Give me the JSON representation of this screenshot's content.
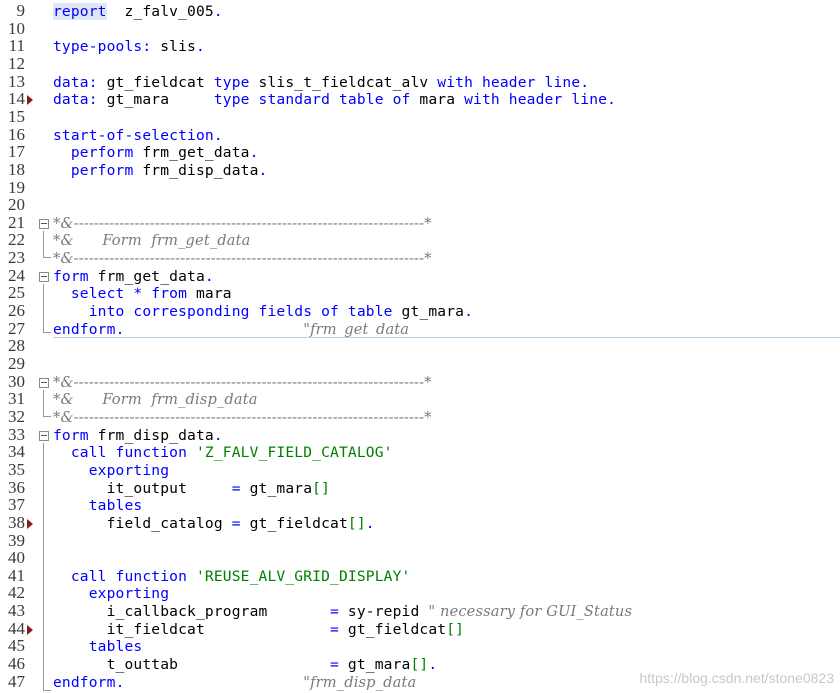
{
  "editor": {
    "highlight_line": "9",
    "lines": [
      {
        "num": "9",
        "marker": false,
        "fold": false,
        "segs": [
          {
            "t": "report",
            "c": "kw"
          },
          {
            "t": "  z_falv_005",
            "c": ""
          },
          {
            "t": ".",
            "c": "kw"
          }
        ]
      },
      {
        "num": "10",
        "marker": false,
        "fold": false,
        "segs": []
      },
      {
        "num": "11",
        "marker": false,
        "fold": false,
        "segs": [
          {
            "t": "type-pools:",
            "c": "kw"
          },
          {
            "t": " slis",
            "c": ""
          },
          {
            "t": ".",
            "c": "kw"
          }
        ]
      },
      {
        "num": "12",
        "marker": false,
        "fold": false,
        "segs": []
      },
      {
        "num": "13",
        "marker": false,
        "fold": false,
        "segs": [
          {
            "t": "data:",
            "c": "kw"
          },
          {
            "t": " gt_fieldcat ",
            "c": ""
          },
          {
            "t": "type",
            "c": "kw"
          },
          {
            "t": " slis_t_fieldcat_alv ",
            "c": ""
          },
          {
            "t": "with header line",
            "c": "kw"
          },
          {
            "t": ".",
            "c": "kw"
          }
        ]
      },
      {
        "num": "14",
        "marker": true,
        "fold": false,
        "segs": [
          {
            "t": "data:",
            "c": "kw"
          },
          {
            "t": " gt_mara     ",
            "c": ""
          },
          {
            "t": "type standard table of",
            "c": "kw"
          },
          {
            "t": " mara ",
            "c": ""
          },
          {
            "t": "with header line",
            "c": "kw"
          },
          {
            "t": ".",
            "c": "kw"
          }
        ]
      },
      {
        "num": "15",
        "marker": false,
        "fold": false,
        "segs": []
      },
      {
        "num": "16",
        "marker": false,
        "fold": false,
        "segs": [
          {
            "t": "start-of-selection",
            "c": "kw"
          },
          {
            "t": ".",
            "c": "kw"
          }
        ]
      },
      {
        "num": "17",
        "marker": false,
        "fold": false,
        "segs": [
          {
            "t": "  perform",
            "c": "kw"
          },
          {
            "t": " frm_get_data",
            "c": ""
          },
          {
            "t": ".",
            "c": "kw"
          }
        ]
      },
      {
        "num": "18",
        "marker": false,
        "fold": false,
        "segs": [
          {
            "t": "  perform",
            "c": "kw"
          },
          {
            "t": " frm_disp_data",
            "c": ""
          },
          {
            "t": ".",
            "c": "kw"
          }
        ]
      },
      {
        "num": "19",
        "marker": false,
        "fold": false,
        "segs": []
      },
      {
        "num": "20",
        "marker": false,
        "fold": false,
        "segs": []
      },
      {
        "num": "21",
        "marker": false,
        "fold": true,
        "segs": [
          {
            "t": "*&---------------------------------------------------------------------*",
            "c": "cm"
          }
        ]
      },
      {
        "num": "22",
        "marker": false,
        "fold": false,
        "segs": [
          {
            "t": "*&      Form  frm_get_data",
            "c": "cm"
          }
        ]
      },
      {
        "num": "23",
        "marker": false,
        "fold": false,
        "segs": [
          {
            "t": "*&---------------------------------------------------------------------*",
            "c": "cm"
          }
        ]
      },
      {
        "num": "24",
        "marker": false,
        "fold": true,
        "segs": [
          {
            "t": "form",
            "c": "kw"
          },
          {
            "t": " frm_get_data",
            "c": ""
          },
          {
            "t": ".",
            "c": "kw"
          }
        ]
      },
      {
        "num": "25",
        "marker": false,
        "fold": false,
        "segs": [
          {
            "t": "  select * from",
            "c": "kw"
          },
          {
            "t": " mara",
            "c": ""
          }
        ]
      },
      {
        "num": "26",
        "marker": false,
        "fold": false,
        "segs": [
          {
            "t": "    into corresponding fields of table",
            "c": "kw"
          },
          {
            "t": " gt_mara",
            "c": ""
          },
          {
            "t": ".",
            "c": "kw"
          }
        ]
      },
      {
        "num": "27",
        "marker": false,
        "fold": false,
        "segs": [
          {
            "t": "endform",
            "c": "kw"
          },
          {
            "t": ".",
            "c": "kw"
          },
          {
            "t": "                    ",
            "c": ""
          },
          {
            "t": "\"frm_get_data",
            "c": "cm"
          }
        ]
      },
      {
        "num": "28",
        "marker": false,
        "fold": false,
        "segs": []
      },
      {
        "num": "29",
        "marker": false,
        "fold": false,
        "segs": []
      },
      {
        "num": "30",
        "marker": false,
        "fold": true,
        "segs": [
          {
            "t": "*&---------------------------------------------------------------------*",
            "c": "cm"
          }
        ]
      },
      {
        "num": "31",
        "marker": false,
        "fold": false,
        "segs": [
          {
            "t": "*&      Form  frm_disp_data",
            "c": "cm"
          }
        ]
      },
      {
        "num": "32",
        "marker": false,
        "fold": false,
        "segs": [
          {
            "t": "*&---------------------------------------------------------------------*",
            "c": "cm"
          }
        ]
      },
      {
        "num": "33",
        "marker": false,
        "fold": true,
        "segs": [
          {
            "t": "form",
            "c": "kw"
          },
          {
            "t": " frm_disp_data",
            "c": ""
          },
          {
            "t": ".",
            "c": "kw"
          }
        ]
      },
      {
        "num": "34",
        "marker": false,
        "fold": false,
        "segs": [
          {
            "t": "  call function",
            "c": "kw"
          },
          {
            "t": " 'Z_FALV_FIELD_CATALOG'",
            "c": "str"
          }
        ]
      },
      {
        "num": "35",
        "marker": false,
        "fold": false,
        "segs": [
          {
            "t": "    exporting",
            "c": "kw"
          }
        ]
      },
      {
        "num": "36",
        "marker": false,
        "fold": false,
        "segs": [
          {
            "t": "      it_output     ",
            "c": ""
          },
          {
            "t": "=",
            "c": "kw"
          },
          {
            "t": " gt_mara",
            "c": ""
          },
          {
            "t": "[]",
            "c": "str"
          }
        ]
      },
      {
        "num": "37",
        "marker": false,
        "fold": false,
        "segs": [
          {
            "t": "    tables",
            "c": "kw"
          }
        ]
      },
      {
        "num": "38",
        "marker": true,
        "fold": false,
        "segs": [
          {
            "t": "      field_catalog ",
            "c": ""
          },
          {
            "t": "=",
            "c": "kw"
          },
          {
            "t": " gt_fieldcat",
            "c": ""
          },
          {
            "t": "[]",
            "c": "str"
          },
          {
            "t": ".",
            "c": "kw"
          }
        ]
      },
      {
        "num": "39",
        "marker": false,
        "fold": false,
        "segs": []
      },
      {
        "num": "40",
        "marker": false,
        "fold": false,
        "segs": []
      },
      {
        "num": "41",
        "marker": false,
        "fold": false,
        "segs": [
          {
            "t": "  call function",
            "c": "kw"
          },
          {
            "t": " 'REUSE_ALV_GRID_DISPLAY'",
            "c": "str"
          }
        ]
      },
      {
        "num": "42",
        "marker": false,
        "fold": false,
        "segs": [
          {
            "t": "    exporting",
            "c": "kw"
          }
        ]
      },
      {
        "num": "43",
        "marker": false,
        "fold": false,
        "segs": [
          {
            "t": "      i_callback_program       ",
            "c": ""
          },
          {
            "t": "=",
            "c": "kw"
          },
          {
            "t": " sy-repid ",
            "c": ""
          },
          {
            "t": "\" necessary for GUI_Status",
            "c": "cm"
          }
        ]
      },
      {
        "num": "44",
        "marker": true,
        "fold": false,
        "segs": [
          {
            "t": "      it_fieldcat              ",
            "c": ""
          },
          {
            "t": "=",
            "c": "kw"
          },
          {
            "t": " gt_fieldcat",
            "c": ""
          },
          {
            "t": "[]",
            "c": "str"
          }
        ]
      },
      {
        "num": "45",
        "marker": false,
        "fold": false,
        "segs": [
          {
            "t": "    tables",
            "c": "kw"
          }
        ]
      },
      {
        "num": "46",
        "marker": false,
        "fold": false,
        "segs": [
          {
            "t": "      t_outtab                 ",
            "c": ""
          },
          {
            "t": "=",
            "c": "kw"
          },
          {
            "t": " gt_mara",
            "c": ""
          },
          {
            "t": "[]",
            "c": "str"
          },
          {
            "t": ".",
            "c": "kw"
          }
        ]
      },
      {
        "num": "47",
        "marker": false,
        "fold": false,
        "segs": [
          {
            "t": "endform",
            "c": "kw"
          },
          {
            "t": ".",
            "c": "kw"
          },
          {
            "t": "                    ",
            "c": ""
          },
          {
            "t": "\"frm_disp_data",
            "c": "cm"
          }
        ]
      }
    ]
  },
  "watermark": "https://blog.csdn.net/stone0823",
  "colors": {
    "keyword": "#0000ff",
    "string": "#008000",
    "comment": "#7a7a7a",
    "marker": "#8b1a1a",
    "highlight": "#dde7f5"
  }
}
